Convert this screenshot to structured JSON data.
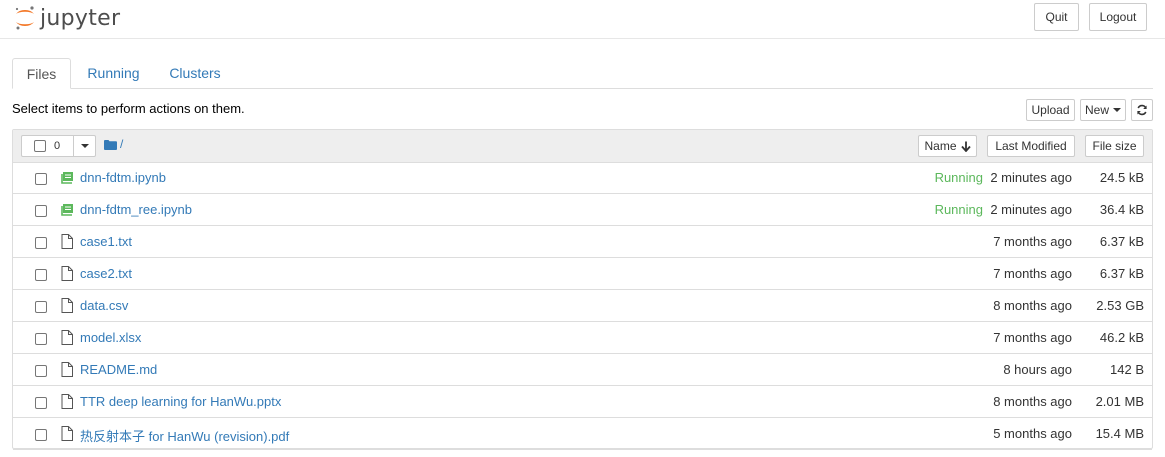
{
  "header": {
    "logo_text": "jupyter",
    "quit_label": "Quit",
    "logout_label": "Logout"
  },
  "tabs": [
    {
      "label": "Files",
      "active": true
    },
    {
      "label": "Running",
      "active": false
    },
    {
      "label": "Clusters",
      "active": false
    }
  ],
  "toolbar": {
    "hint": "Select items to perform actions on them.",
    "upload_label": "Upload",
    "new_label": "New",
    "refresh_icon": "refresh-icon"
  },
  "list_header": {
    "selected_count": "0",
    "path": "/",
    "sort_name": "Name",
    "sort_modified": "Last Modified",
    "sort_size": "File size"
  },
  "files": [
    {
      "name": "dnn-fdtm.ipynb",
      "type": "notebook",
      "status": "Running",
      "modified": "2 minutes ago",
      "size": "24.5 kB"
    },
    {
      "name": "dnn-fdtm_ree.ipynb",
      "type": "notebook",
      "status": "Running",
      "modified": "2 minutes ago",
      "size": "36.4 kB"
    },
    {
      "name": "case1.txt",
      "type": "file",
      "status": "",
      "modified": "7 months ago",
      "size": "6.37 kB"
    },
    {
      "name": "case2.txt",
      "type": "file",
      "status": "",
      "modified": "7 months ago",
      "size": "6.37 kB"
    },
    {
      "name": "data.csv",
      "type": "file",
      "status": "",
      "modified": "8 months ago",
      "size": "2.53 GB"
    },
    {
      "name": "model.xlsx",
      "type": "file",
      "status": "",
      "modified": "7 months ago",
      "size": "46.2 kB"
    },
    {
      "name": "README.md",
      "type": "file",
      "status": "",
      "modified": "8 hours ago",
      "size": "142 B"
    },
    {
      "name": "TTR deep learning for HanWu.pptx",
      "type": "file",
      "status": "",
      "modified": "8 months ago",
      "size": "2.01 MB"
    },
    {
      "name": "热反射本子 for HanWu (revision).pdf",
      "type": "file",
      "status": "",
      "modified": "5 months ago",
      "size": "15.4 MB"
    }
  ],
  "colors": {
    "link": "#337ab7",
    "running": "#5cb85c",
    "notebook_icon": "#5cb85c",
    "logo_orange": "#f37726"
  }
}
